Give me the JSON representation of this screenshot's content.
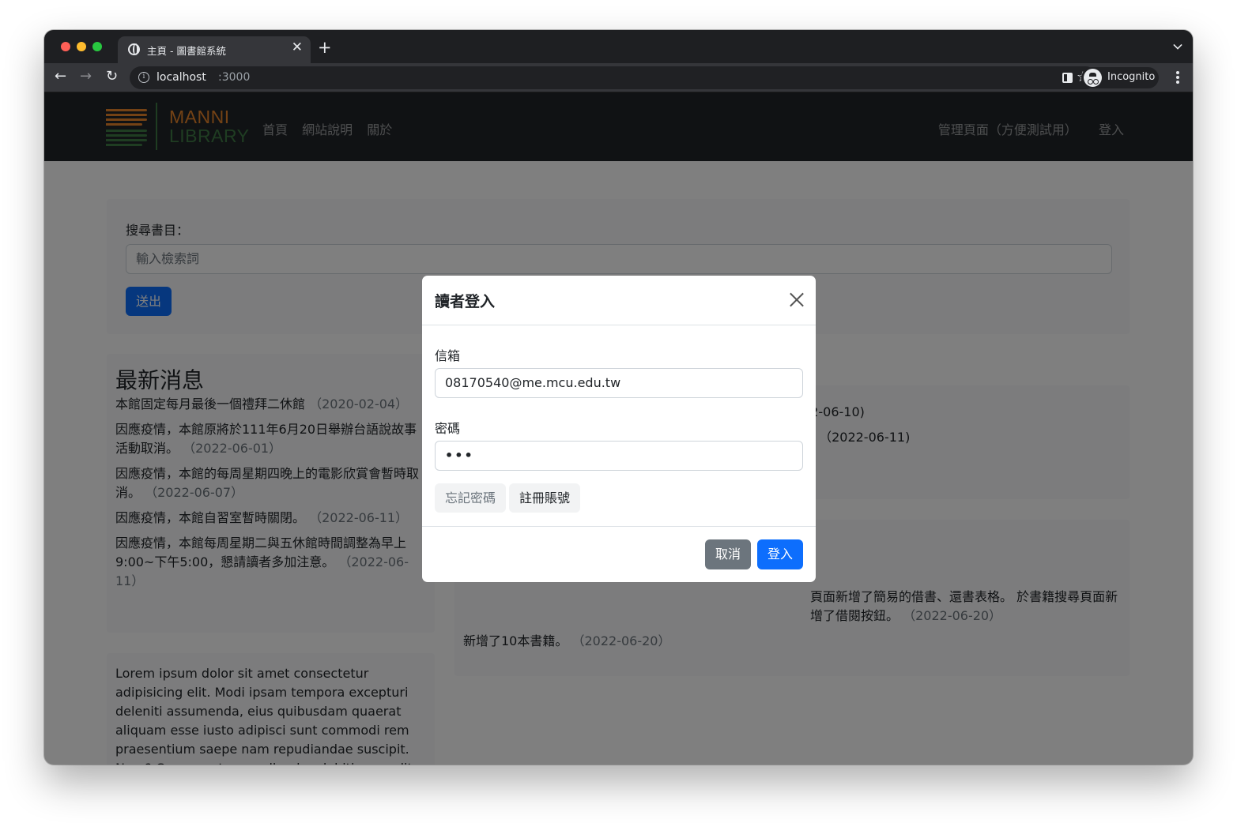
{
  "browser": {
    "tab_title": "主頁 - 圖書館系統",
    "url_host": "localhost",
    "url_port": ":3000",
    "profile_label": "Incognito",
    "icons": [
      "globe-icon",
      "close-icon",
      "plus-icon",
      "back-arrow-icon",
      "forward-arrow-icon",
      "reload-icon",
      "info-icon",
      "star-icon",
      "side-panel-icon",
      "incognito-icon",
      "kebab-menu-icon",
      "chevron-down-icon"
    ]
  },
  "site": {
    "logo_line1": "MANNI",
    "logo_line2": "LIBRARY",
    "nav_left": [
      "首頁",
      "網站說明",
      "關於"
    ],
    "nav_admin": "管理頁面（方便測試用）",
    "nav_login": "登入"
  },
  "search": {
    "label": "搜尋書目：",
    "placeholder": "輸入檢索詞",
    "submit": "送出"
  },
  "news": {
    "title": "最新消息",
    "items": [
      {
        "text": "本館固定每月最後一個禮拜二休館",
        "date": "（2020-02-04）"
      },
      {
        "text": "因應疫情，本館原將於111年6月20日舉辦台語說故事活動取消。",
        "date": "（2022-06-01）"
      },
      {
        "text": "因應疫情，本館的每周星期四晚上的電影欣賞會暫時取消。",
        "date": "（2022-06-07）"
      },
      {
        "text": "因應疫情，本館自習室暫時關閉。",
        "date": "（2022-06-11）"
      },
      {
        "text": "因應疫情，本館每周星期二與五休館時間調整為早上9:00~下午5:00，懇請讀者多加注意。",
        "date": "（2022-06-11）"
      }
    ]
  },
  "lorem": "Lorem ipsum dolor sit amet consectetur adipisicing elit. Modi ipsam tempora excepturi deleniti assumenda, eius quibusdam quaerat aliquam esse iusto adipisci sunt commodi rem praesentium saepe nam repudiandae suscipit. Nam? Consequatur repellendus debitis expedita ratione inventore voluptatum reiciendis natus voluptate, cupiditate,",
  "right_panel": {
    "line1": "22-06-10)",
    "line2": "。 （2022-06-11)",
    "update1": "頁面新增了簡易的借書、還書表格。 於書籍搜尋頁面新增了借閱按鈕。",
    "update1_date": "（2022-06-20）",
    "update2": "新增了10本書籍。",
    "update2_date": "（2022-06-20）"
  },
  "modal": {
    "title": "讀者登入",
    "email_label": "信箱",
    "email_value": "08170540@me.mcu.edu.tw",
    "password_label": "密碼",
    "password_value": "•••",
    "forgot": "忘記密碼",
    "register": "註冊賬號",
    "cancel": "取消",
    "login": "登入"
  },
  "colors": {
    "primary": "#0d6efd",
    "secondary": "#6c757d",
    "navbar": "#212529",
    "logo_orange": "#e8842b",
    "logo_green": "#3f7a45"
  }
}
